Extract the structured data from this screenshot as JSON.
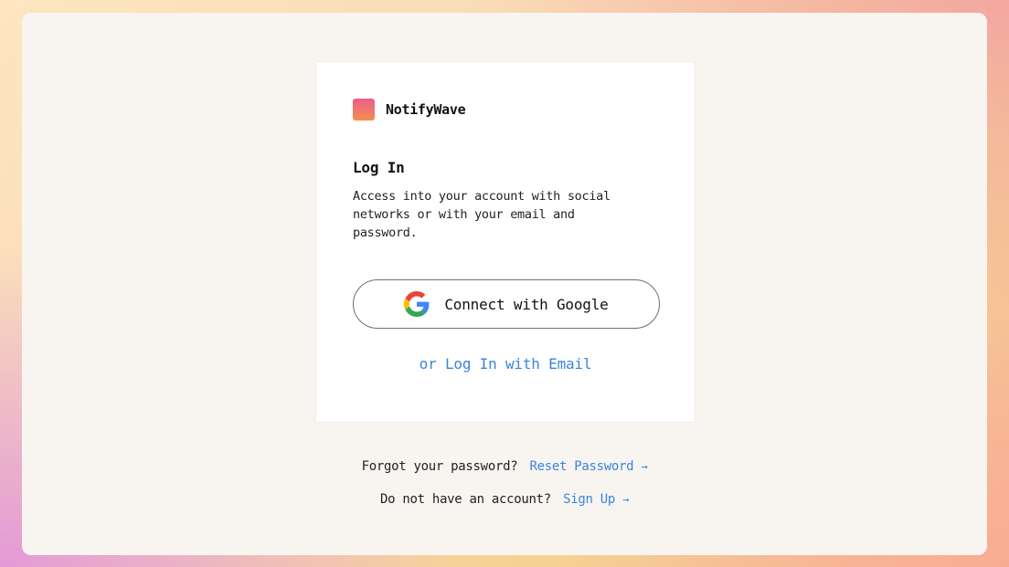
{
  "brand": {
    "name": "NotifyWave",
    "logo_gradient": [
      "#ec5d8e",
      "#f3904b"
    ]
  },
  "login": {
    "title": "Log In",
    "description": "Access into your account with social networks or with your email and password.",
    "google_button_label": "Connect with Google",
    "google_icon": "google-icon",
    "email_link": "or Log In with Email"
  },
  "footer": {
    "forgot_text": "Forgot your password?",
    "reset_link": "Reset Password",
    "reset_arrow": "→",
    "no_account_text": "Do not have an account?",
    "signup_link": "Sign Up",
    "signup_arrow": "→"
  },
  "colors": {
    "link": "#3a84de",
    "panel": "#f8f5f1",
    "card": "#ffffff"
  }
}
